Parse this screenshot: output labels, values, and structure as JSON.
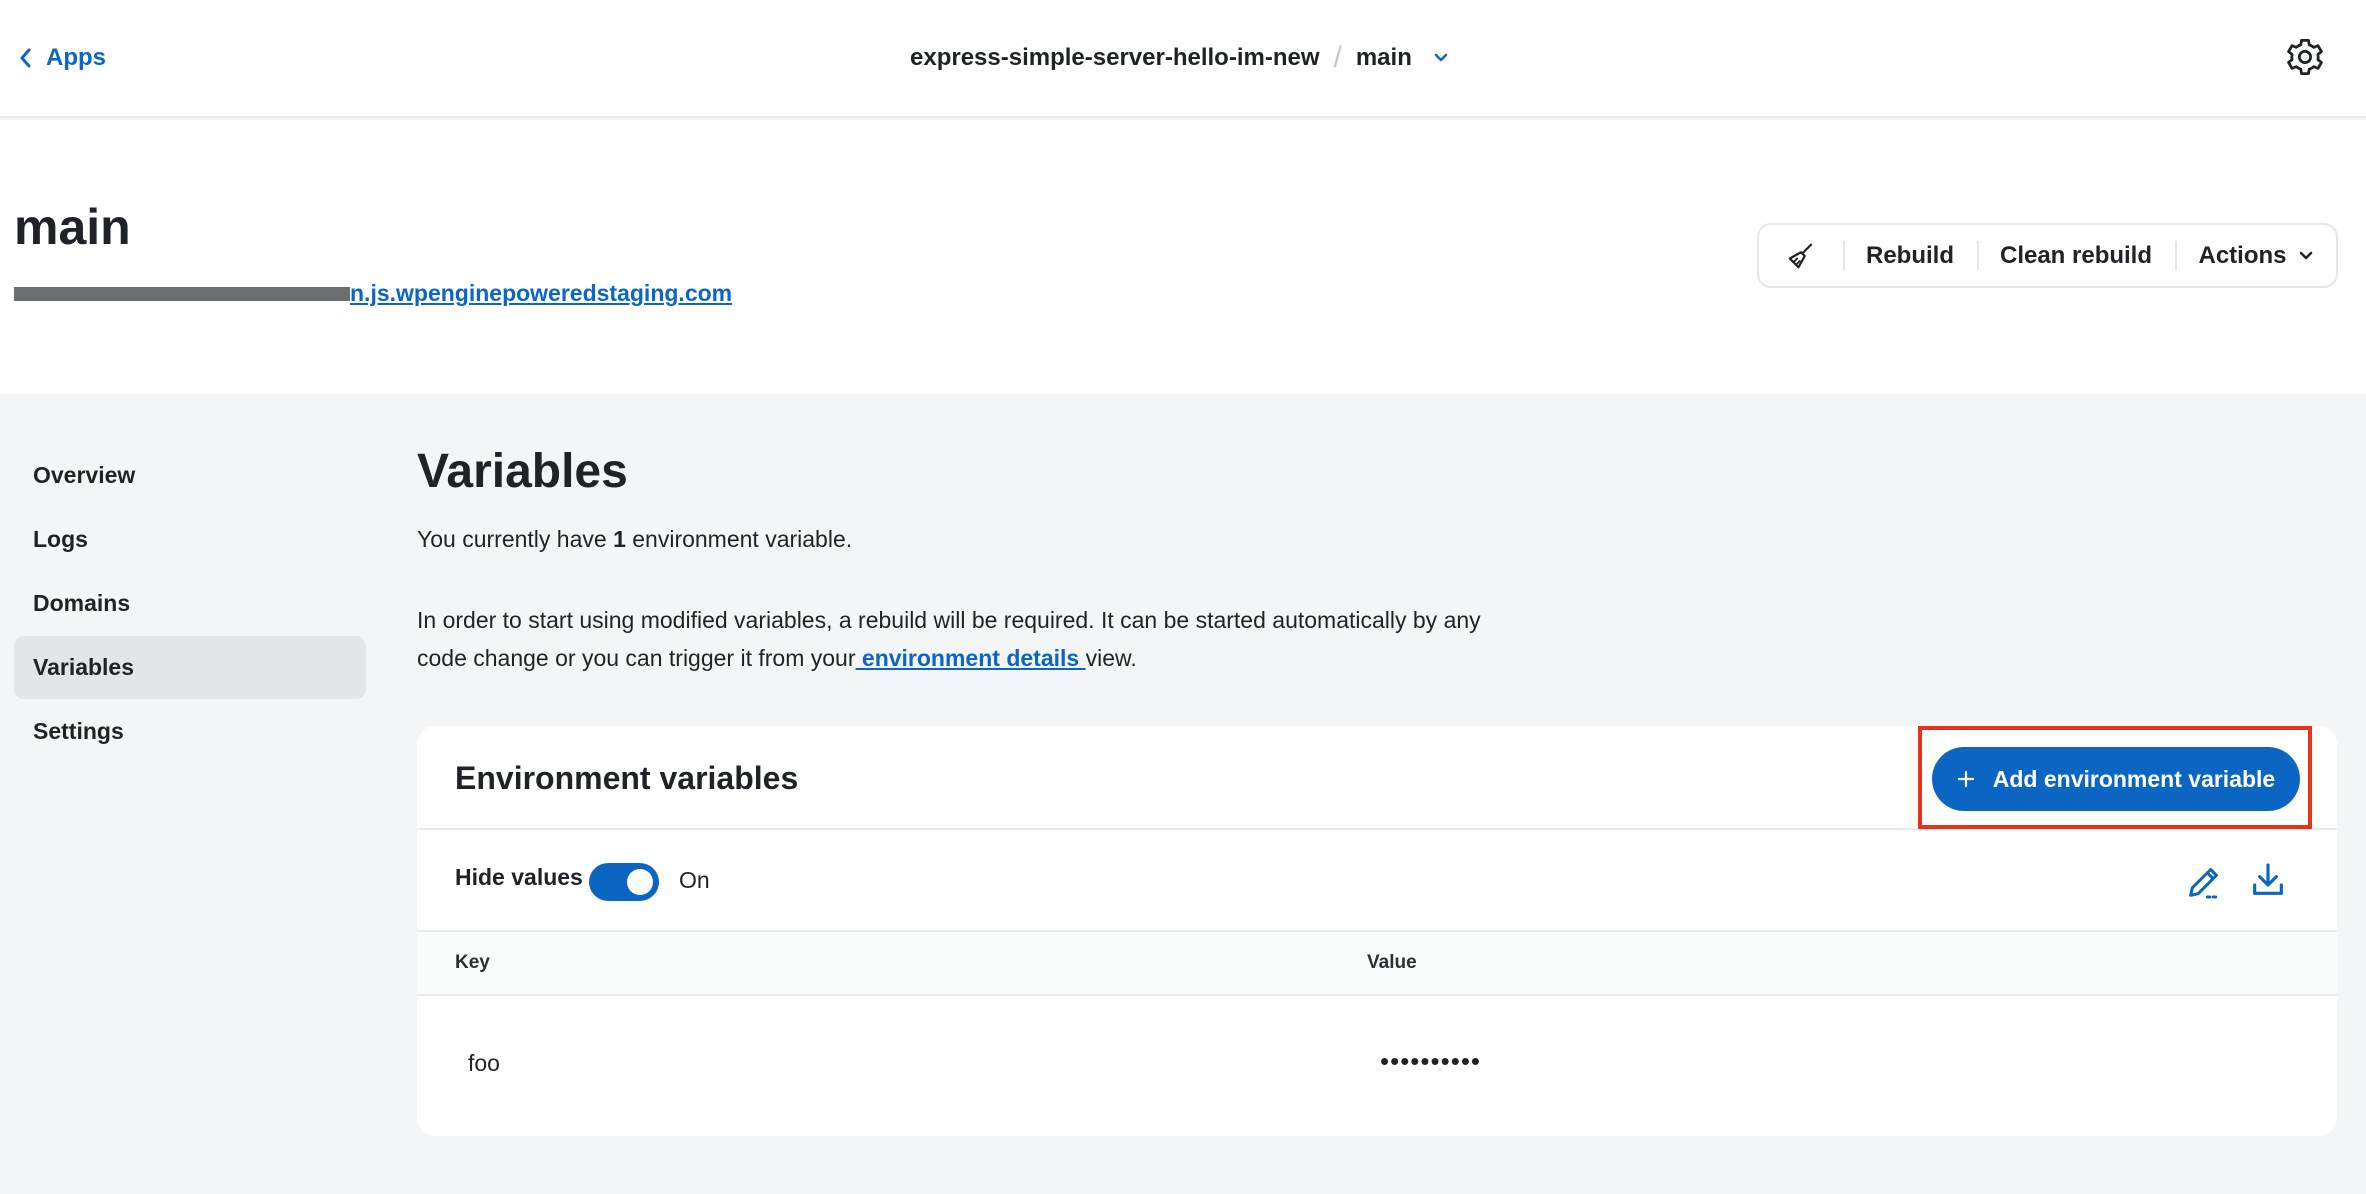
{
  "topbar": {
    "back_label": "Apps",
    "app_name": "express-simple-server-hello-im-new",
    "separator": "/",
    "branch": "main"
  },
  "header": {
    "environment_name": "main",
    "url_visible_suffix": "n.js.wpenginepoweredstaging.com",
    "toolbar": {
      "rebuild": "Rebuild",
      "clean_rebuild": "Clean rebuild",
      "actions": "Actions"
    }
  },
  "sidebar": {
    "items": [
      {
        "label": "Overview"
      },
      {
        "label": "Logs"
      },
      {
        "label": "Domains"
      },
      {
        "label": "Variables",
        "active": true
      },
      {
        "label": "Settings"
      }
    ]
  },
  "main": {
    "title": "Variables",
    "count_prefix": "You currently have ",
    "count_value": "1",
    "count_suffix": " environment variable.",
    "info_before_link": "In order to start using modified variables, a rebuild will be required. It can be started automatically by any code change or you can trigger it from your",
    "info_link": " environment details ",
    "info_after_link": "view."
  },
  "card": {
    "title": "Environment variables",
    "add_button": "Add environment variable",
    "hide_values_label": "Hide values",
    "hide_values_state": "On",
    "columns": [
      "Key",
      "Value"
    ],
    "rows": [
      {
        "key": "foo",
        "value": "••••••••••"
      }
    ]
  },
  "colors": {
    "accent": "#0b66c3",
    "highlight": "#e8321c",
    "active_nav": "#e2e6e7",
    "page_bg": "#f4f5f6"
  }
}
